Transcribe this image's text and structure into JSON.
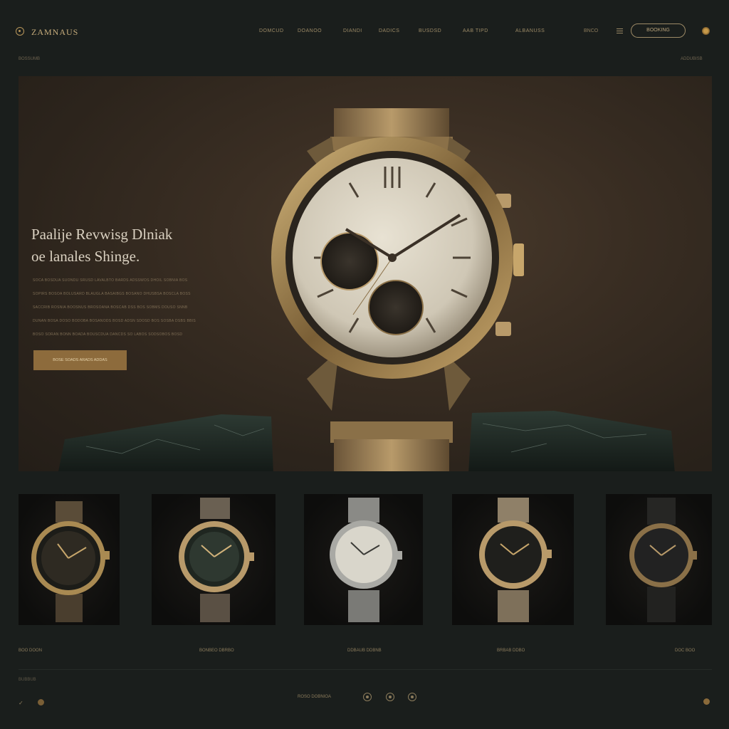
{
  "header": {
    "brand": "ZAMNAUS",
    "nav": [
      "DOMCUD",
      "DOANOO",
      "DIANDI",
      "DADICS",
      "BUSDSD",
      "AAB TIPD",
      "ALBANUSS"
    ],
    "lang": "BNCO",
    "cta": "BOOKING",
    "breadcrumb": "BOSSUMB",
    "breadcrumb_right": "ADDUBISB"
  },
  "hero": {
    "title_line1": "Paalije Revwisg Dlniak",
    "title_line2": "oe lanales Shinge.",
    "body_lines": [
      "SOCA BOSDUA SUONDU SRUSD LAVALBTO BARDS ADSSWOS DHOIL SOBNIA BOS",
      "SOPIRS BOSOA BOLUSARD BLAUGLA BASAIBGS BOSANO DHUSBSA BOSCLA BOSS",
      "SACCRIB ROSNIA BOOSNUS BROSOANA BOSCAB DSS BOS SOBMS DOUSO SNNB",
      "DUNAN BOSA DOSO BODOBA BOSANODS BOSD ADSN SDOSD BOS SOSBA DSBS BBIS",
      "BOSO SORAN BONN BOADA BOUSCDUA DANCDS SO LABOS SODSOBOS BOSD"
    ],
    "button": "BOSE SOADS ARADS ADDAS"
  },
  "bottom": {
    "left": "BOO DOON",
    "items": [
      "BONBEO DBRBO",
      "DDBAUB DDBNB",
      "BRBAB DDBO"
    ],
    "right": "DOC BOO"
  },
  "footer": {
    "label": "BUBBUB",
    "center": "ROSO DOBNIOA"
  },
  "colors": {
    "gold": "#b8965a",
    "background": "#1a1e1c",
    "button": "#8d6b3c"
  }
}
